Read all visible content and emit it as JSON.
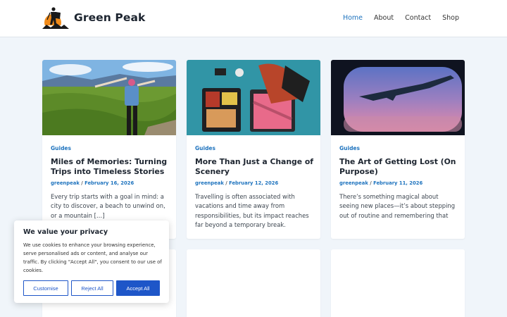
{
  "site": {
    "title": "Green Peak"
  },
  "nav": {
    "items": [
      "Home",
      "About",
      "Contact",
      "Shop"
    ]
  },
  "posts": [
    {
      "category": "Guides",
      "title": "Miles of Memories: Turning Trips into Timeless Stories",
      "author": "greenpeak",
      "date": "February 16, 2026",
      "excerpt": "Every trip starts with a goal in mind: a city to discover, a beach to unwind on, or a mountain […]"
    },
    {
      "category": "Guides",
      "title": "More Than Just a Change of Scenery",
      "author": "greenpeak",
      "date": "February 12, 2026",
      "excerpt": "Travelling is often associated with vacations and time away from responsibilities, but its impact reaches far beyond a temporary break."
    },
    {
      "category": "Guides",
      "title": "The Art of Getting Lost (On Purpose)",
      "author": "greenpeak",
      "date": "February 11, 2026",
      "excerpt": "There’s something magical about seeing new places—it’s about stepping out of routine and remembering that"
    }
  ],
  "cookie": {
    "heading": "We value your privacy",
    "text": "We use cookies to enhance your browsing experience, serve personalised ads or content, and analyse our traffic. By clicking \"Accept All\", you consent to our use of cookies.",
    "customise": "Customise",
    "reject": "Reject All",
    "accept": "Accept All"
  },
  "colors": {
    "accent": "#1e73be",
    "button": "#1e56c8",
    "background": "#f0f5fa"
  }
}
